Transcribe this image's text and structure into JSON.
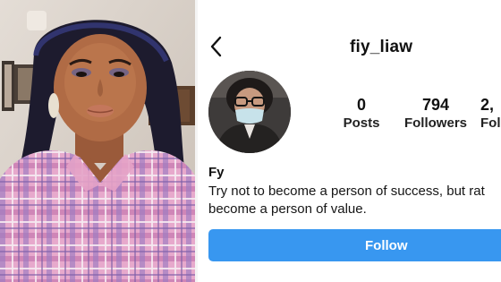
{
  "profile": {
    "username": "fiy_liaw",
    "stats": {
      "posts_value": "0",
      "posts_label": "Posts",
      "followers_value": "794",
      "followers_label": "Followers",
      "following_value": "2,",
      "following_label": "Follo"
    },
    "bio": {
      "name": "Fy",
      "line1": "Try not to become a person of success, but rat",
      "line2": "become a person of value."
    },
    "follow_label": "Follow"
  },
  "icons": {
    "back": "chevron-left-icon"
  },
  "colors": {
    "follow_button": "#3897f0",
    "text": "#111111",
    "background": "#ffffff"
  }
}
